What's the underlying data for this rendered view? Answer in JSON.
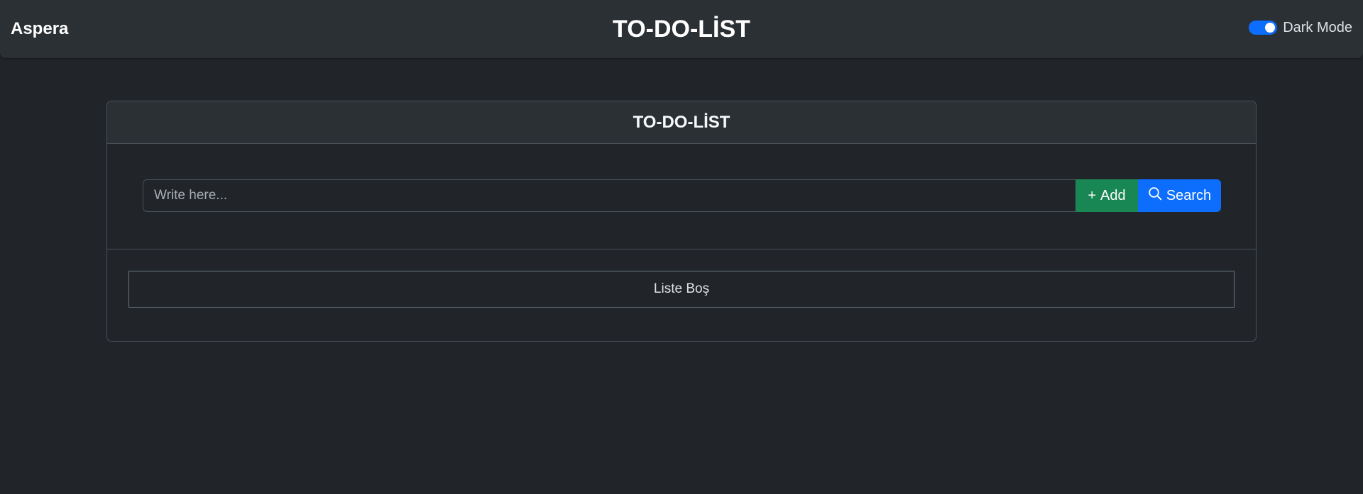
{
  "navbar": {
    "brand": "Aspera",
    "title": "TO-DO-LİST",
    "dark_mode_label": "Dark Mode",
    "dark_mode_on": true
  },
  "card": {
    "header": "TO-DO-LİST",
    "input": {
      "value": "",
      "placeholder": "Write here..."
    },
    "add_button": {
      "icon": "plus-icon",
      "label": "Add"
    },
    "search_button": {
      "icon": "search-icon",
      "label": "Search"
    },
    "empty_message": "Liste Boş"
  },
  "colors": {
    "background": "#212529",
    "navbar": "#2b3035",
    "add": "#198754",
    "search": "#0d6efd",
    "toggle": "#0d6efd"
  }
}
